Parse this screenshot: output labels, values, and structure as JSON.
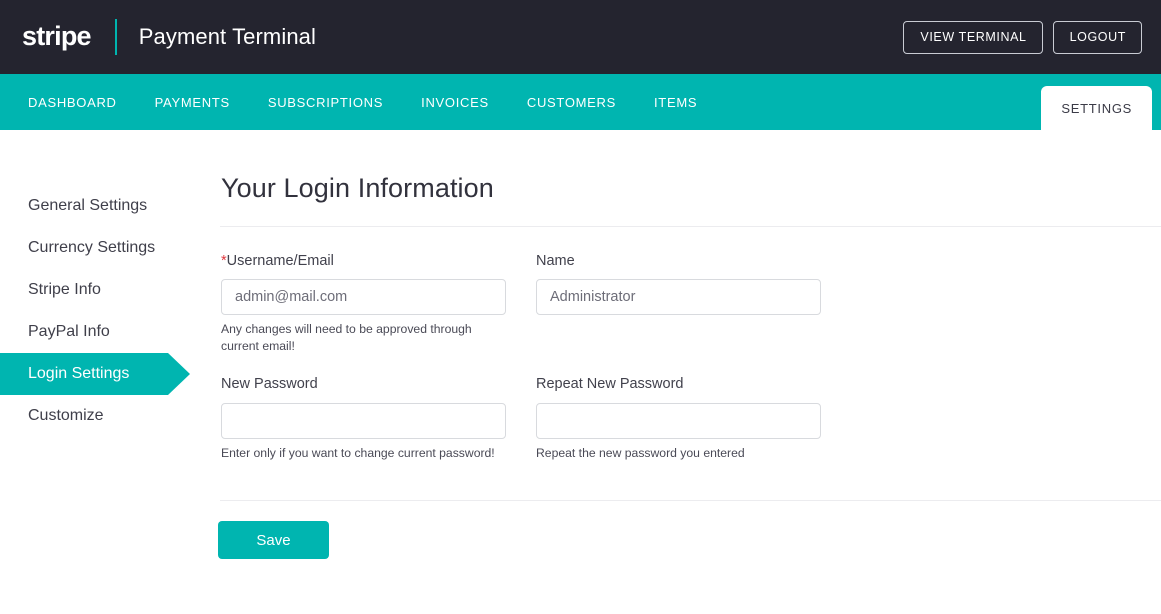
{
  "header": {
    "logo_text": "stripe",
    "title": "Payment Terminal",
    "view_terminal_label": "VIEW TERMINAL",
    "logout_label": "LOGOUT",
    "background_color": "#24242f",
    "accent_color": "#00b5b0"
  },
  "nav": {
    "items": [
      {
        "label": "DASHBOARD"
      },
      {
        "label": "PAYMENTS"
      },
      {
        "label": "SUBSCRIPTIONS"
      },
      {
        "label": "INVOICES"
      },
      {
        "label": "CUSTOMERS"
      },
      {
        "label": "ITEMS"
      }
    ],
    "active_tab": {
      "label": "SETTINGS"
    }
  },
  "sidebar": {
    "items": [
      {
        "label": "General Settings",
        "active": false
      },
      {
        "label": "Currency Settings",
        "active": false
      },
      {
        "label": "Stripe Info",
        "active": false
      },
      {
        "label": "PayPal Info",
        "active": false
      },
      {
        "label": "Login Settings",
        "active": true
      },
      {
        "label": "Customize",
        "active": false
      }
    ]
  },
  "main": {
    "page_title": "Your Login Information",
    "fields": {
      "username": {
        "label": "Username/Email",
        "required_marker": "*",
        "value": "admin@mail.com",
        "help": "Any changes will need to be approved through current email!"
      },
      "name": {
        "label": "Name",
        "value": "Administrator",
        "help": ""
      },
      "new_password": {
        "label": "New Password",
        "value": "",
        "help": "Enter only if you want to change current password!"
      },
      "repeat_password": {
        "label": "Repeat New Password",
        "value": "",
        "help": "Repeat the new password you entered"
      }
    },
    "save_label": "Save"
  }
}
